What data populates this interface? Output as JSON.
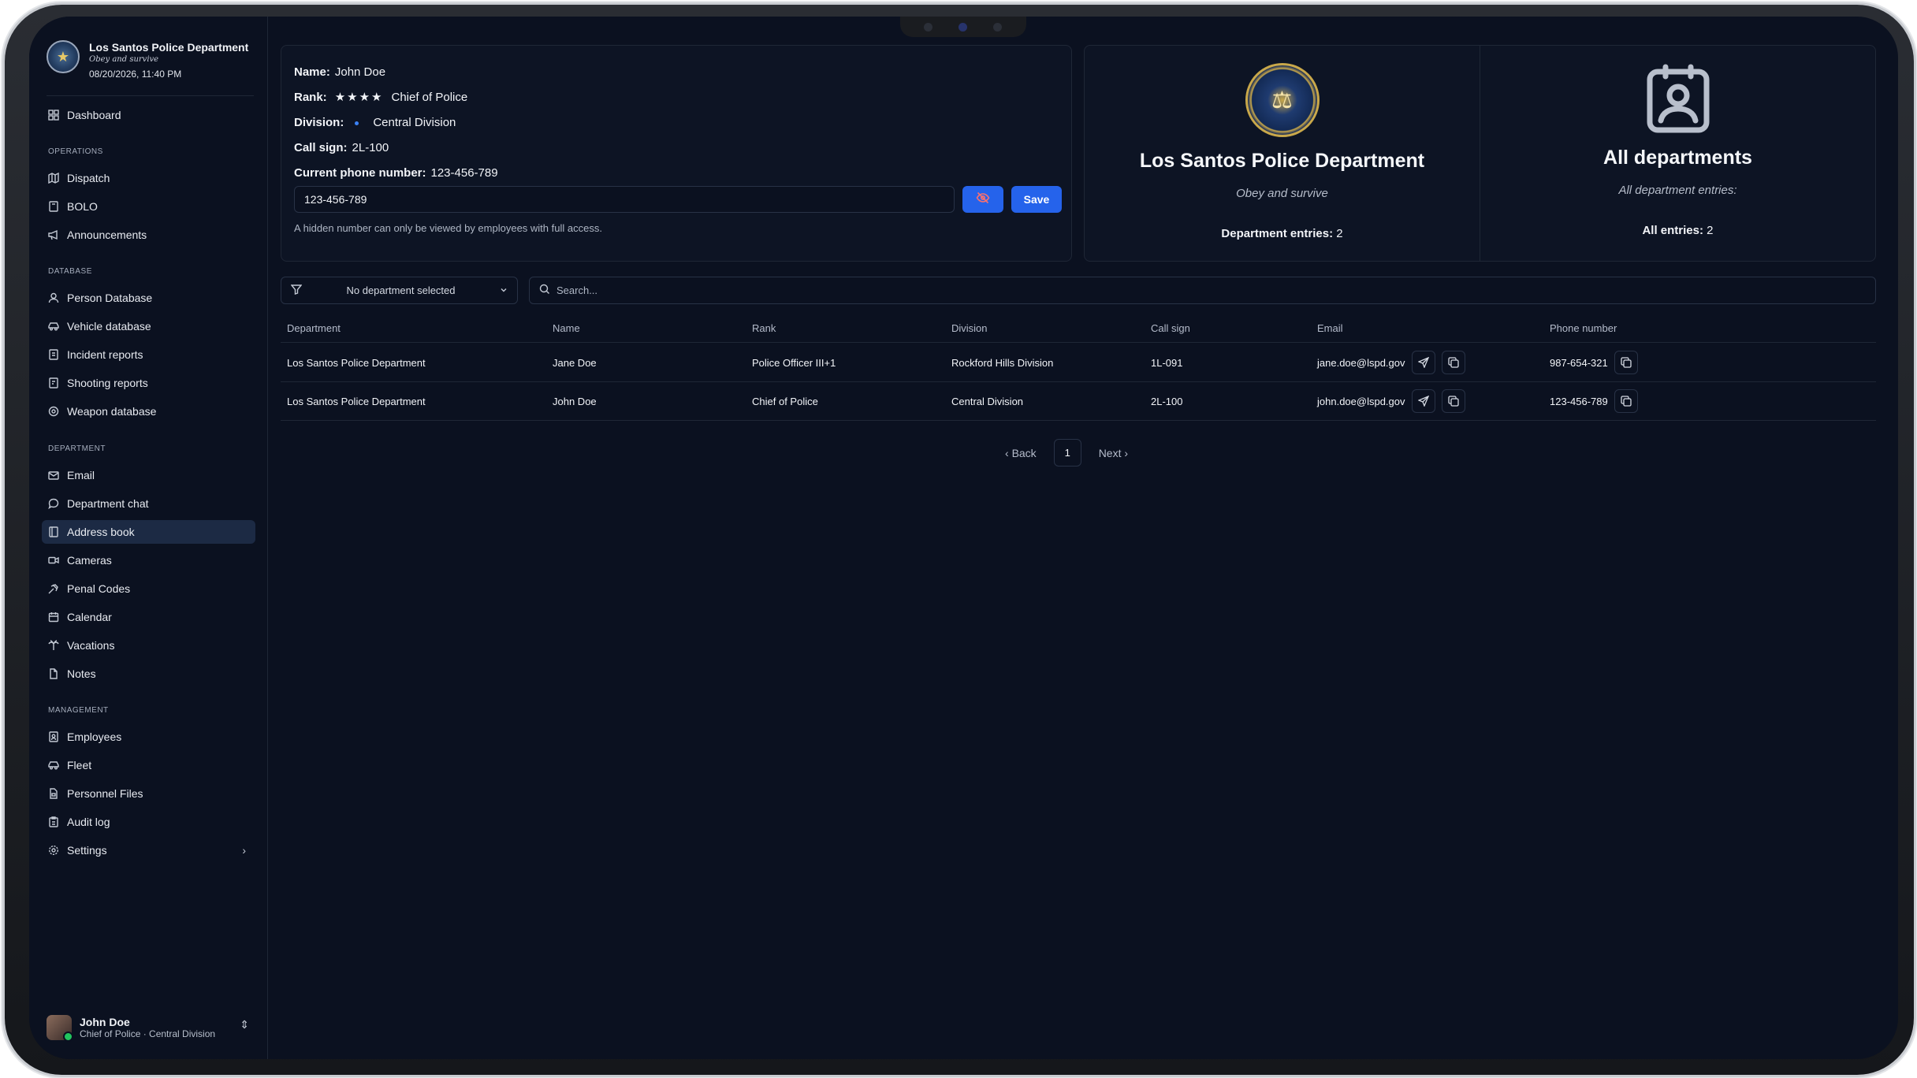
{
  "brand": {
    "name": "Los Santos Police Department",
    "motto": "Obey and survive",
    "datetime": "08/20/2026, 11:40 PM"
  },
  "nav": {
    "dashboard": "Dashboard",
    "sections": {
      "operations": "OPERATIONS",
      "database": "DATABASE",
      "department": "DEPARTMENT",
      "management": "MANAGEMENT"
    },
    "items": {
      "dispatch": "Dispatch",
      "bolo": "BOLO",
      "announcements": "Announcements",
      "person_database": "Person Database",
      "vehicle_database": "Vehicle database",
      "incident_reports": "Incident reports",
      "shooting_reports": "Shooting reports",
      "weapon_database": "Weapon database",
      "email": "Email",
      "department_chat": "Department chat",
      "address_book": "Address book",
      "cameras": "Cameras",
      "penal_codes": "Penal Codes",
      "calendar": "Calendar",
      "vacations": "Vacations",
      "notes": "Notes",
      "employees": "Employees",
      "fleet": "Fleet",
      "personnel_files": "Personnel Files",
      "audit_log": "Audit log",
      "settings": "Settings"
    }
  },
  "user": {
    "name": "John Doe",
    "subtitle": "Chief of Police · Central Division"
  },
  "profile": {
    "name_label": "Name:",
    "name": "John Doe",
    "rank_label": "Rank:",
    "rank_stars": "★★★★",
    "rank": "Chief of Police",
    "division_label": "Division:",
    "division": "Central Division",
    "callsign_label": "Call sign:",
    "callsign": "2L-100",
    "phone_label": "Current phone number:",
    "phone": "123-456-789",
    "phone_input_value": "123-456-789",
    "save_label": "Save",
    "hint": "A hidden number can only be viewed by employees with full access."
  },
  "department_card": {
    "title": "Los Santos Police Department",
    "motto": "Obey and survive",
    "count_label": "Department entries:",
    "count": "2"
  },
  "all_card": {
    "title": "All departments",
    "subtitle": "All department entries:",
    "count_label": "All entries:",
    "count": "2"
  },
  "filter": {
    "label": "No department selected"
  },
  "search": {
    "placeholder": "Search..."
  },
  "table": {
    "headers": {
      "department": "Department",
      "name": "Name",
      "rank": "Rank",
      "division": "Division",
      "callsign": "Call sign",
      "email": "Email",
      "phone": "Phone number"
    },
    "rows": [
      {
        "department": "Los Santos Police Department",
        "name": "Jane Doe",
        "rank": "Police Officer III+1",
        "division": "Rockford Hills Division",
        "callsign": "1L-091",
        "email": "jane.doe@lspd.gov",
        "phone": "987-654-321"
      },
      {
        "department": "Los Santos Police Department",
        "name": "John Doe",
        "rank": "Chief of Police",
        "division": "Central Division",
        "callsign": "2L-100",
        "email": "john.doe@lspd.gov",
        "phone": "123-456-789"
      }
    ]
  },
  "pagination": {
    "back": "Back",
    "page": "1",
    "next": "Next"
  },
  "colors": {
    "accent": "#2563eb",
    "background": "#0b1120",
    "active_nav": "#1c2a44",
    "division_dot": "#3b82f6"
  }
}
